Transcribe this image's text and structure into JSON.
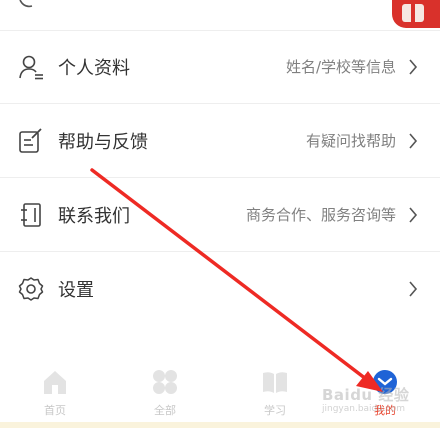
{
  "menu": [
    {
      "title": "个人资料",
      "desc": "姓名/学校等信息",
      "icon": "profile-icon"
    },
    {
      "title": "帮助与反馈",
      "desc": "有疑问找帮助",
      "icon": "edit-feedback-icon"
    },
    {
      "title": "联系我们",
      "desc": "商务合作、服务咨询等",
      "icon": "contact-book-icon"
    },
    {
      "title": "设置",
      "desc": "",
      "icon": "settings-icon"
    }
  ],
  "tabs": [
    {
      "label": "首页",
      "icon": "home-icon"
    },
    {
      "label": "全部",
      "icon": "grid-icon"
    },
    {
      "label": "学习",
      "icon": "book-icon"
    },
    {
      "label": "我的",
      "icon": "user-icon"
    }
  ],
  "watermark": {
    "text": "Baidu 经验",
    "sub": "jingyan.baidu.com"
  },
  "colors": {
    "accent": "#e8442e",
    "text": "#333333",
    "muted": "#808080",
    "tab_inactive": "#c8c8c8"
  }
}
